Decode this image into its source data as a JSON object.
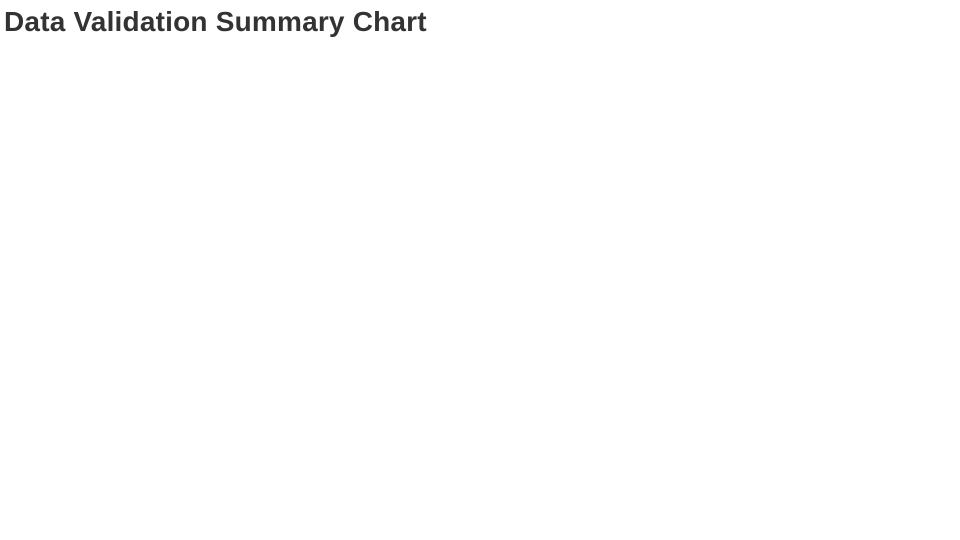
{
  "title": "Data Validation Summary Chart"
}
